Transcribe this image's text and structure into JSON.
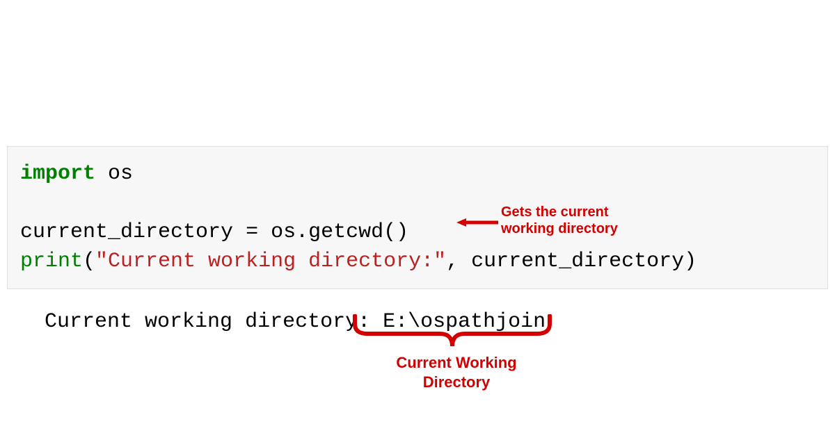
{
  "code": {
    "line1_keyword": "import",
    "line1_rest": " os",
    "line3_var": "current_directory ",
    "line3_eq": "=",
    "line3_rest": " os.getcwd()",
    "line4_func": "print",
    "line4_open": "(",
    "line4_string": "\"Current working directory:\"",
    "line4_rest": ", current_directory)"
  },
  "output": {
    "text": "Current working directory: E:\\ospathjoin"
  },
  "annotations": {
    "arrow_label_line1": "Gets the current",
    "arrow_label_line2": "working directory",
    "brace_label_line1": "Current Working",
    "brace_label_line2": "Directory"
  },
  "colors": {
    "annotation": "#d20000",
    "keyword_green": "#008000",
    "string_red": "#BA2121",
    "code_bg": "#f7f7f7"
  }
}
